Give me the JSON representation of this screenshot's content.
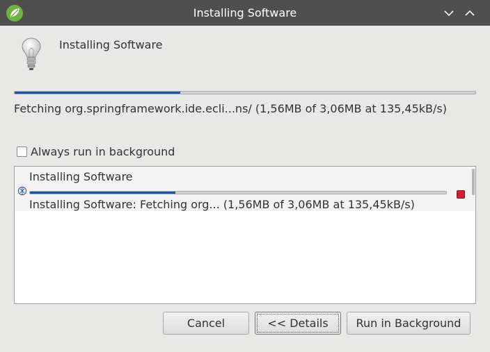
{
  "window": {
    "title": "Installing Software",
    "titlebar_color": "#4f4f4f",
    "icons": [
      "spring-logo-icon",
      "chevron-down-icon",
      "chevron-up-icon"
    ]
  },
  "header": {
    "title": "Installing Software",
    "icon": "lightbulb-icon"
  },
  "progress": {
    "fraction": 0.36,
    "status": "Fetching org.springframework.ide.ecli...ns/ (1,56MB of 3,06MB at 135,45kB/s)",
    "bar_color": "#1c55a8"
  },
  "options": {
    "always_run_background_label": "Always run in background",
    "always_run_background_checked": false
  },
  "jobs": [
    {
      "title": "Installing Software",
      "status": "Installing Software: Fetching org... (1,56MB of 3,06MB at 135,45kB/s)",
      "progress_fraction": 0.35,
      "icon": "job-progress-icon",
      "cancel_icon": "stop-icon"
    }
  ],
  "buttons": {
    "cancel": "Cancel",
    "details": "<< Details",
    "run_in_background": "Run in Background"
  }
}
